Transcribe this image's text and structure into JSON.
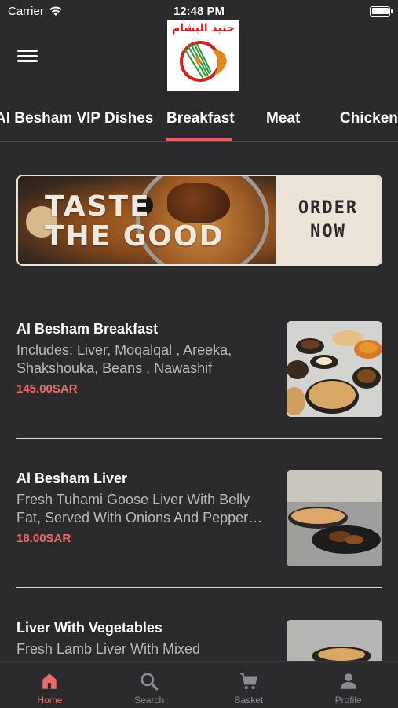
{
  "status_bar": {
    "carrier": "Carrier",
    "time": "12:48 PM"
  },
  "header": {
    "logo_text": "حنيذ البشام"
  },
  "category_tabs": [
    {
      "label": "Al Besham VIP Dishes"
    },
    {
      "label": "Breakfast"
    },
    {
      "label": "Meat"
    },
    {
      "label": "Chicken"
    }
  ],
  "active_tab": "Breakfast",
  "banner": {
    "title": "TASTE\nTHE GOOD",
    "cta": "ORDER\nNOW"
  },
  "menu_items": [
    {
      "name": "Al Besham Breakfast",
      "description": "Includes: Liver, Moqalqal , Areeka, Shakshouka, Beans , Nawashif",
      "price": "145.00SAR"
    },
    {
      "name": "Al Besham Liver",
      "description": "Fresh Tuhami Goose Liver With Belly Fat, Served With Onions And Pepper…",
      "price": "18.00SAR"
    },
    {
      "name": "Liver With Vegetables",
      "description": "Fresh Lamb Liver With Mixed",
      "price": ""
    }
  ],
  "bottom_nav": [
    {
      "label": "Home",
      "icon": "home-icon"
    },
    {
      "label": "Search",
      "icon": "search-icon"
    },
    {
      "label": "Basket",
      "icon": "cart-icon"
    },
    {
      "label": "Profile",
      "icon": "profile-icon"
    }
  ],
  "colors": {
    "background": "#2b2b2e",
    "accent": "#ec6a6a",
    "text_muted": "#b9b9bc"
  }
}
